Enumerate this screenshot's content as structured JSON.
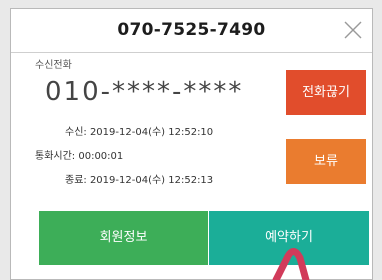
{
  "header": {
    "title": "070-7525-7490"
  },
  "call": {
    "incoming_label": "수신전화",
    "number": "010-****-****",
    "received": "수신: 2019-12-04(수) 12:52:10",
    "duration": "통화시간: 00:00:01",
    "ended": "종료: 2019-12-04(수) 12:52:13"
  },
  "buttons": {
    "hangup": "전화끊기",
    "hold": "보류",
    "member_info": "회원정보",
    "reserve": "예약하기"
  },
  "colors": {
    "hangup": "#e14d2c",
    "hold": "#ea7c2f",
    "member_info": "#3dae58",
    "reserve": "#1bae98"
  }
}
